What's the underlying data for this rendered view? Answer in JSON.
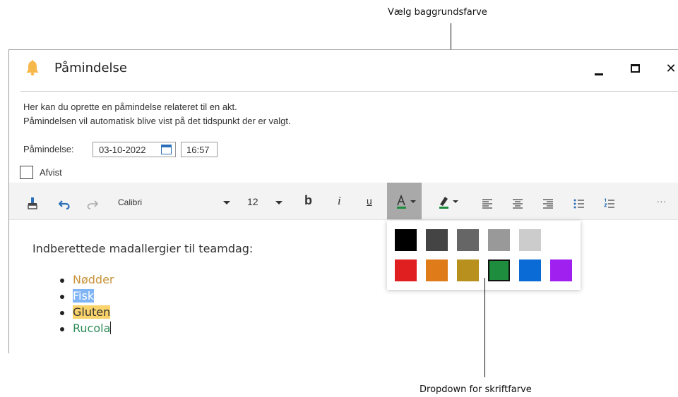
{
  "callouts": {
    "background_color": "Vælg baggrundsfarve",
    "font_color_dropdown": "Dropdown for skriftfarve"
  },
  "window": {
    "title": "Påmindelse",
    "controls": {
      "minimize": "minimize",
      "maximize": "maximize",
      "close": "✕"
    }
  },
  "form": {
    "info_line1": "Her kan du oprette en påmindelse relateret til en akt.",
    "info_line2": "Påmindelsen vil automatisk blive vist på det tidspunkt der er valgt.",
    "reminder_label": "Påmindelse:",
    "date": "03-10-2022",
    "time": "16:57",
    "rejected_label": "Afvist",
    "rejected_checked": false
  },
  "toolbar": {
    "font": "Calibri",
    "size": "12",
    "bold": "b",
    "italic": "i",
    "underline": "u",
    "more": "...",
    "font_color_accent": "#1e8e3e",
    "highlight_accent": "#1e8e3e",
    "icons": [
      "format-painter-icon",
      "undo-icon",
      "redo-icon",
      "font-color-icon",
      "highlight-icon",
      "align-left-icon",
      "align-center-icon",
      "align-right-icon",
      "bulleted-list-icon",
      "numbered-list-icon"
    ]
  },
  "editor": {
    "heading": "Indberettede madallergier til teamdag:",
    "items": [
      {
        "text": "Nødder",
        "color": "#c8933b",
        "highlight": ""
      },
      {
        "text": "Fisk",
        "color": "#ffffff",
        "highlight": "#7fb4f5"
      },
      {
        "text": "Gluten",
        "color": "#333333",
        "highlight": "#fbd36b"
      },
      {
        "text": "Rucola",
        "color": "#2e8b57",
        "highlight": ""
      }
    ]
  },
  "palette": {
    "row1": [
      "#000000",
      "#444444",
      "#666666",
      "#999999",
      "#cccccc"
    ],
    "row2": [
      "#e02020",
      "#e07b1a",
      "#b8901e",
      "#1e8e3e",
      "#0a6ad6",
      "#a020f0"
    ],
    "selected": "#1e8e3e"
  }
}
